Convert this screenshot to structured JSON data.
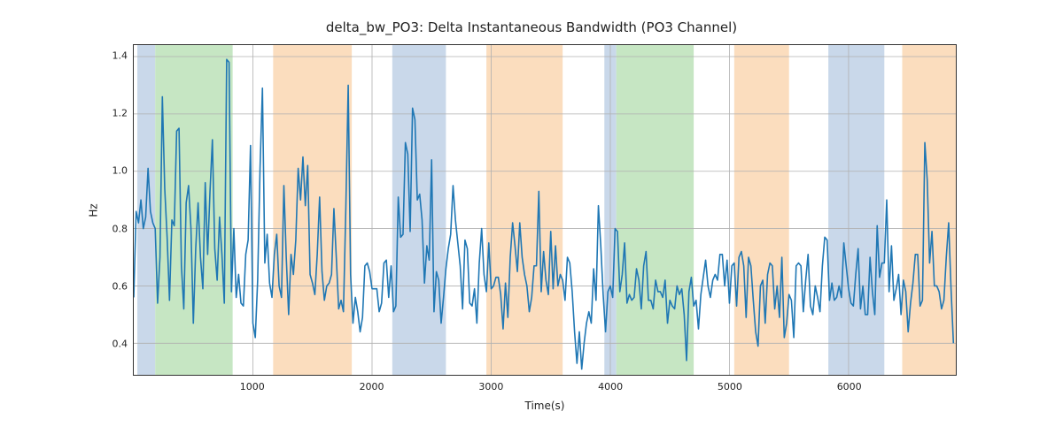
{
  "chart_data": {
    "type": "line",
    "title": "delta_bw_PO3: Delta Instantaneous Bandwidth (PO3 Channel)",
    "xlabel": "Time(s)",
    "ylabel": "Hz",
    "xlim": [
      0,
      6900
    ],
    "ylim": [
      0.29,
      1.44
    ],
    "xticks": [
      1000,
      2000,
      3000,
      4000,
      5000,
      6000
    ],
    "yticks": [
      0.4,
      0.6,
      0.8,
      1.0,
      1.2,
      1.4
    ],
    "line_color": "#1f77b4",
    "band_colors": {
      "blue": "#c9d8ea",
      "green": "#c6e6c3",
      "orange": "#fbddbe"
    },
    "bands": [
      {
        "x0": 30,
        "x1": 180,
        "color": "blue"
      },
      {
        "x0": 180,
        "x1": 830,
        "color": "green"
      },
      {
        "x0": 1170,
        "x1": 1830,
        "color": "orange"
      },
      {
        "x0": 2170,
        "x1": 2620,
        "color": "blue"
      },
      {
        "x0": 2960,
        "x1": 3600,
        "color": "orange"
      },
      {
        "x0": 3950,
        "x1": 4050,
        "color": "blue"
      },
      {
        "x0": 4050,
        "x1": 4700,
        "color": "green"
      },
      {
        "x0": 5040,
        "x1": 5500,
        "color": "orange"
      },
      {
        "x0": 5830,
        "x1": 6300,
        "color": "blue"
      },
      {
        "x0": 6450,
        "x1": 6900,
        "color": "orange"
      }
    ],
    "x_step": 20,
    "series": [
      {
        "name": "delta_bw_PO3",
        "values": [
          0.56,
          0.86,
          0.82,
          0.9,
          0.8,
          0.84,
          1.01,
          0.86,
          0.82,
          0.8,
          0.54,
          0.7,
          1.26,
          0.94,
          0.77,
          0.55,
          0.83,
          0.81,
          1.14,
          1.15,
          0.67,
          0.52,
          0.89,
          0.95,
          0.8,
          0.47,
          0.73,
          0.89,
          0.7,
          0.59,
          0.96,
          0.71,
          0.93,
          1.11,
          0.73,
          0.62,
          0.84,
          0.71,
          0.54,
          1.39,
          1.38,
          0.58,
          0.8,
          0.56,
          0.64,
          0.54,
          0.53,
          0.71,
          0.76,
          1.09,
          0.47,
          0.42,
          0.62,
          1.01,
          1.29,
          0.68,
          0.78,
          0.61,
          0.56,
          0.71,
          0.78,
          0.6,
          0.56,
          0.95,
          0.7,
          0.5,
          0.71,
          0.64,
          0.76,
          1.01,
          0.9,
          1.05,
          0.88,
          1.02,
          0.64,
          0.61,
          0.57,
          0.71,
          0.91,
          0.65,
          0.55,
          0.6,
          0.61,
          0.64,
          0.87,
          0.7,
          0.52,
          0.55,
          0.51,
          0.87,
          1.3,
          0.64,
          0.47,
          0.56,
          0.51,
          0.44,
          0.49,
          0.67,
          0.68,
          0.65,
          0.59,
          0.59,
          0.59,
          0.51,
          0.54,
          0.68,
          0.69,
          0.56,
          0.67,
          0.51,
          0.53,
          0.91,
          0.77,
          0.78,
          1.1,
          1.06,
          0.79,
          1.22,
          1.18,
          0.9,
          0.92,
          0.83,
          0.61,
          0.74,
          0.69,
          1.04,
          0.51,
          0.65,
          0.62,
          0.47,
          0.56,
          0.66,
          0.73,
          0.78,
          0.95,
          0.83,
          0.75,
          0.67,
          0.52,
          0.76,
          0.73,
          0.54,
          0.53,
          0.59,
          0.47,
          0.68,
          0.8,
          0.64,
          0.58,
          0.75,
          0.59,
          0.6,
          0.63,
          0.63,
          0.57,
          0.45,
          0.61,
          0.49,
          0.7,
          0.82,
          0.74,
          0.65,
          0.82,
          0.7,
          0.64,
          0.6,
          0.51,
          0.56,
          0.67,
          0.67,
          0.93,
          0.58,
          0.72,
          0.62,
          0.57,
          0.79,
          0.59,
          0.74,
          0.6,
          0.64,
          0.62,
          0.55,
          0.7,
          0.68,
          0.58,
          0.44,
          0.33,
          0.44,
          0.31,
          0.4,
          0.47,
          0.51,
          0.47,
          0.66,
          0.55,
          0.88,
          0.74,
          0.57,
          0.44,
          0.58,
          0.6,
          0.56,
          0.8,
          0.79,
          0.58,
          0.64,
          0.75,
          0.54,
          0.57,
          0.55,
          0.56,
          0.66,
          0.62,
          0.52,
          0.67,
          0.72,
          0.55,
          0.55,
          0.52,
          0.62,
          0.58,
          0.58,
          0.56,
          0.62,
          0.47,
          0.55,
          0.53,
          0.52,
          0.6,
          0.57,
          0.59,
          0.5,
          0.34,
          0.58,
          0.63,
          0.53,
          0.55,
          0.45,
          0.57,
          0.63,
          0.69,
          0.6,
          0.56,
          0.62,
          0.64,
          0.62,
          0.71,
          0.71,
          0.6,
          0.69,
          0.54,
          0.67,
          0.68,
          0.53,
          0.7,
          0.72,
          0.67,
          0.49,
          0.7,
          0.67,
          0.55,
          0.44,
          0.39,
          0.6,
          0.62,
          0.47,
          0.64,
          0.68,
          0.67,
          0.52,
          0.6,
          0.49,
          0.7,
          0.42,
          0.47,
          0.57,
          0.55,
          0.42,
          0.67,
          0.68,
          0.67,
          0.51,
          0.62,
          0.71,
          0.53,
          0.5,
          0.6,
          0.56,
          0.51,
          0.67,
          0.77,
          0.76,
          0.55,
          0.61,
          0.55,
          0.56,
          0.6,
          0.56,
          0.75,
          0.67,
          0.59,
          0.54,
          0.53,
          0.64,
          0.73,
          0.52,
          0.6,
          0.5,
          0.5,
          0.7,
          0.58,
          0.5,
          0.81,
          0.63,
          0.68,
          0.68,
          0.9,
          0.58,
          0.74,
          0.55,
          0.59,
          0.64,
          0.5,
          0.62,
          0.58,
          0.44,
          0.54,
          0.61,
          0.71,
          0.71,
          0.53,
          0.55,
          1.1,
          0.97,
          0.68,
          0.79,
          0.6,
          0.6,
          0.58,
          0.52,
          0.55,
          0.7,
          0.82,
          0.59,
          0.4
        ]
      }
    ]
  }
}
